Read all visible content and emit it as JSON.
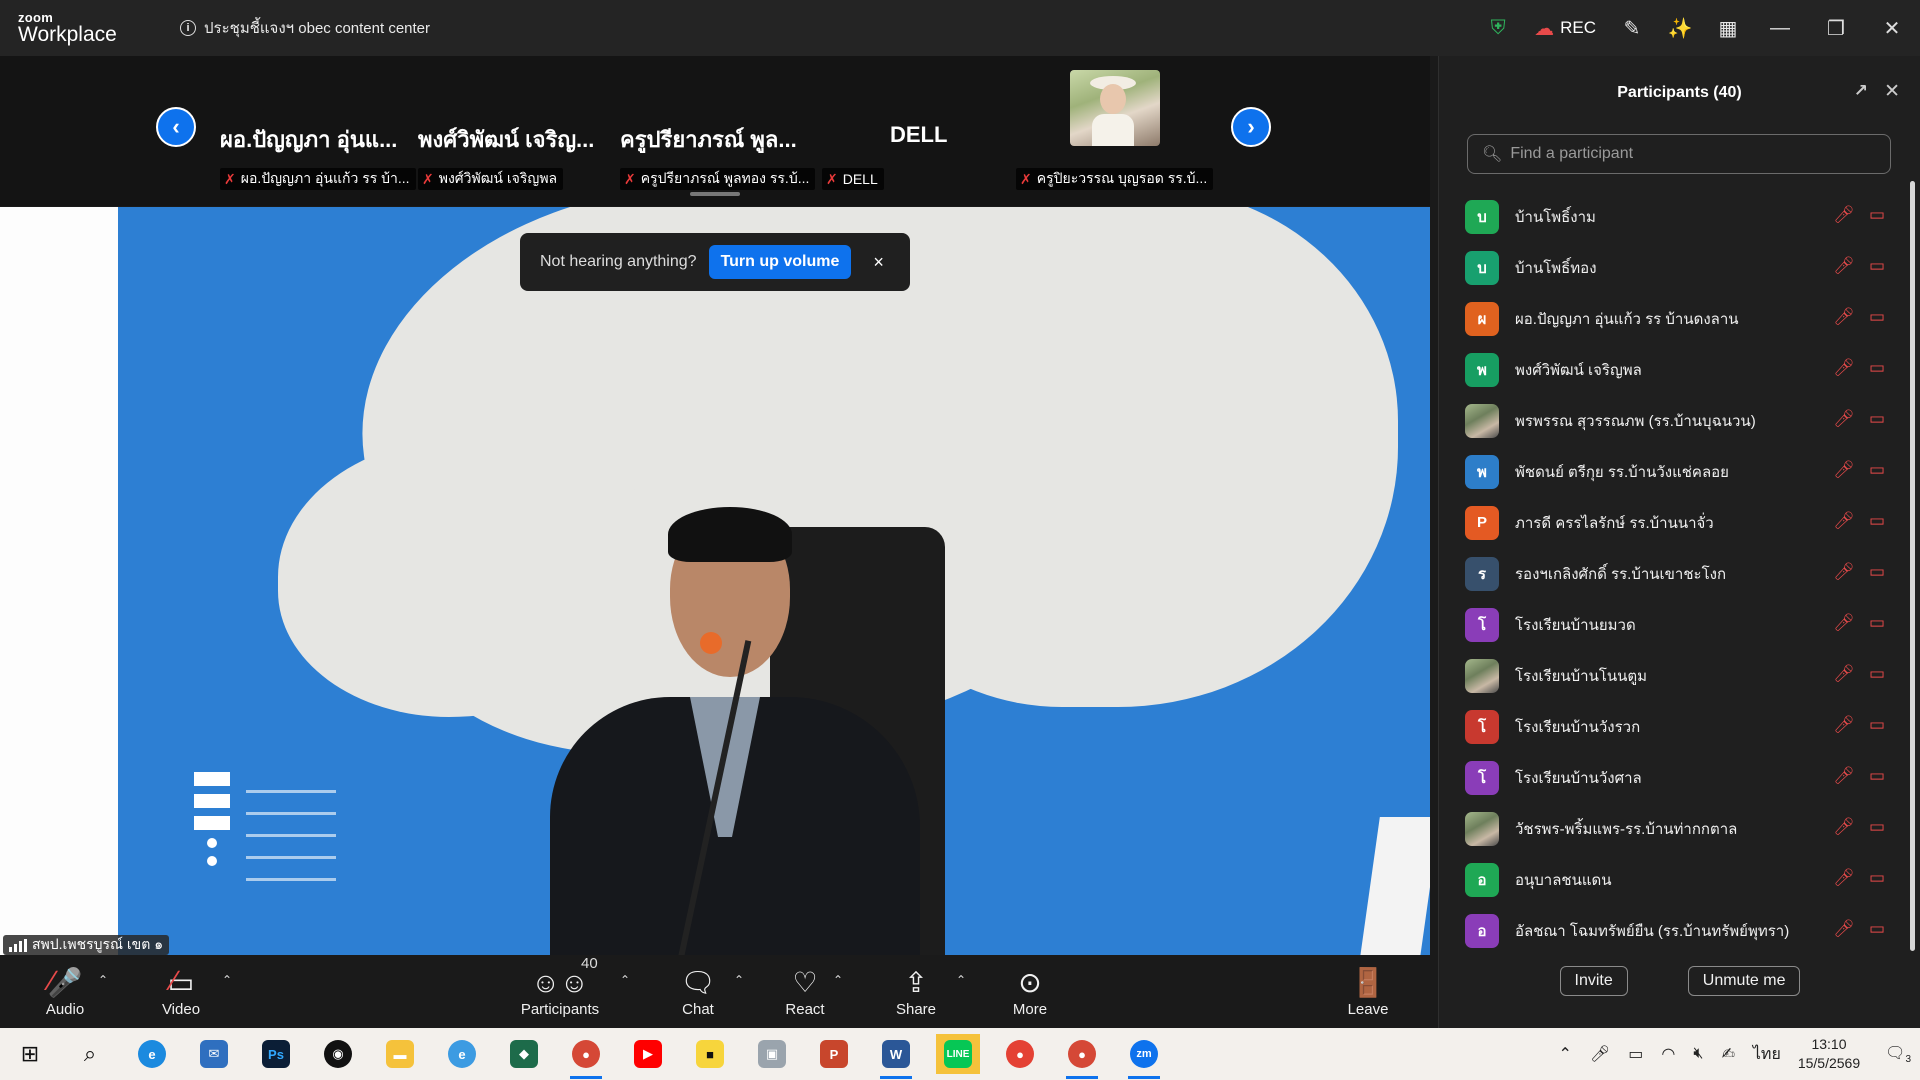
{
  "app": {
    "logo_line1": "zoom",
    "logo_line2": "Workplace",
    "meeting_title": "ประชุมชี้แจงฯ obec content center",
    "rec_label": "REC"
  },
  "gallery": {
    "tiles": [
      {
        "big_name": "ผอ.ปัญญภา อุ่นแ...",
        "label": "ผอ.ปัญญภา อุ่นแก้ว รร บ้า..."
      },
      {
        "big_name": "พงศ์วิพัฒน์ เจริญ...",
        "label": "พงศ์วิพัฒน์ เจริญพล"
      },
      {
        "big_name": "ครูปรียาภรณ์ พูล...",
        "label": "ครูปรียาภรณ์ พูลทอง รร.บ้..."
      },
      {
        "big_name": "DELL",
        "label": "DELL"
      },
      {
        "big_name": "",
        "label": "ครูปิยะวรรณ บุญรอด รร.บ้..."
      }
    ]
  },
  "toast": {
    "text": "Not hearing anything?",
    "button": "Turn up volume",
    "close": "×"
  },
  "active_speaker": "สพป.เพชรบูรณ์ เขต ๑",
  "toolbar": {
    "audio": "Audio",
    "video": "Video",
    "participants": "Participants",
    "participants_count": "40",
    "chat": "Chat",
    "react": "React",
    "share": "Share",
    "more": "More",
    "leave": "Leave"
  },
  "panel": {
    "title": "Participants (40)",
    "search_placeholder": "Find a participant",
    "participants": [
      {
        "initial": "บ",
        "name": "บ้านโพธิ์งาม",
        "color": "#1fa855"
      },
      {
        "initial": "บ",
        "name": "บ้านโพธิ์ทอง",
        "color": "#18a06f"
      },
      {
        "initial": "ผ",
        "name": "ผอ.ปัญญภา อุ่นแก้ว รร บ้านดงลาน",
        "color": "#e0621f"
      },
      {
        "initial": "พ",
        "name": "พงศ์วิพัฒน์ เจริญพล",
        "color": "#179e62"
      },
      {
        "initial": "",
        "name": "พรพรรณ สุวรรณภพ (รร.บ้านบุฉนวน)",
        "color": "photo"
      },
      {
        "initial": "พ",
        "name": "พัชดนย์ ตรีกุย รร.บ้านวังแช่คลอย",
        "color": "#2d7ec9"
      },
      {
        "initial": "P",
        "name": "ภารดี ครรไลรักษ์ รร.บ้านนาจั่ว",
        "color": "#e45a23"
      },
      {
        "initial": "ร",
        "name": "รองฯเกลิงศักดิ์ รร.บ้านเขาชะโงก",
        "color": "#37506c"
      },
      {
        "initial": "โ",
        "name": "โรงเรียนบ้านยมวด",
        "color": "#8a3db8"
      },
      {
        "initial": "",
        "name": "โรงเรียนบ้านโนนตูม",
        "color": "photo"
      },
      {
        "initial": "โ",
        "name": "โรงเรียนบ้านวังรวก",
        "color": "#c8392f"
      },
      {
        "initial": "โ",
        "name": "โรงเรียนบ้านวังศาล",
        "color": "#8a3db8"
      },
      {
        "initial": "",
        "name": "วัชรพร-พริ้มแพร-รร.บ้านท่ากกตาล",
        "color": "photo"
      },
      {
        "initial": "อ",
        "name": "อนุบาลชนแดน",
        "color": "#1fa855"
      },
      {
        "initial": "อ",
        "name": "อัลชณา โฉมทรัพย์ยืน (รร.บ้านทรัพย์พุทรา)",
        "color": "#8a3db8"
      }
    ],
    "invite": "Invite",
    "unmute": "Unmute me"
  },
  "taskbar": {
    "lang": "ไทย",
    "time": "13:10",
    "date": "15/5/2569",
    "notif_count": "3"
  }
}
